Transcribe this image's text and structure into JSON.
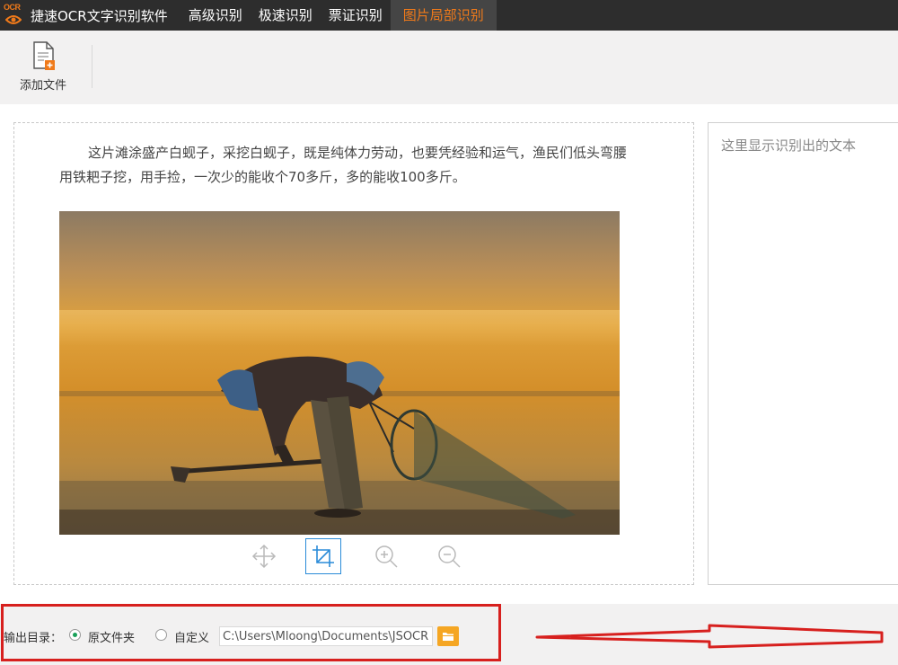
{
  "app": {
    "logo_text": "OCR",
    "title": "捷速OCR文字识别软件"
  },
  "tabs": [
    {
      "label": "高级识别",
      "active": false
    },
    {
      "label": "极速识别",
      "active": false
    },
    {
      "label": "票证识别",
      "active": false
    },
    {
      "label": "图片局部识别",
      "active": true
    }
  ],
  "toolbar": {
    "add_file_label": "添加文件"
  },
  "document": {
    "paragraph": "这片滩涂盛产白蚬子，采挖白蚬子，既是纯体力劳动，也要凭经验和运气，渔民们低头弯腰用铁耙子挖，用手捡，一次少的能收个70多斤，多的能收100多斤。"
  },
  "image_tools": [
    {
      "icon": "move-icon",
      "active": false
    },
    {
      "icon": "crop-icon",
      "active": true
    },
    {
      "icon": "zoom-in-icon",
      "active": false
    },
    {
      "icon": "zoom-out-icon",
      "active": false
    }
  ],
  "result": {
    "placeholder": "这里显示识别出的文本"
  },
  "output": {
    "label": "输出目录：",
    "option_original": "原文件夹",
    "option_custom": "自定义",
    "selected": "原文件夹",
    "path_value": "C:\\Users\\Mloong\\Documents\\JSOCR"
  },
  "colors": {
    "topbar_bg": "#2d2d2d",
    "accent": "#f07a1a",
    "annotation_red": "#d7201e",
    "radio_checked": "#18a058",
    "active_tool_border": "#2a8bd8",
    "folder_button": "#f5a623"
  }
}
